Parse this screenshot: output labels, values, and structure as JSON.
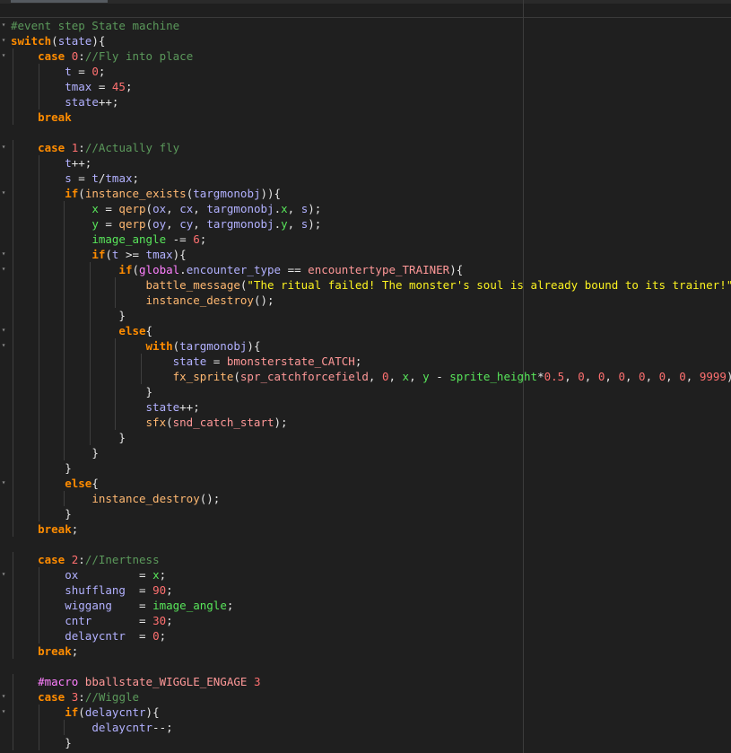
{
  "editor": {
    "colors": {
      "background": "#1f1f1f",
      "default": "#e6e6e6",
      "keyword": "#ff8c00",
      "number": "#ff7070",
      "string": "#fcf320",
      "comment": "#5b995b",
      "function": "#ffb871",
      "variable": "#b2b1ff",
      "builtin_var": "#58e55a",
      "operator": "#ff8080",
      "constant": "#ff8080",
      "global": "#ff80ff"
    },
    "fold_icon": "fold-triangle-icon",
    "lines": [
      {
        "tokens": [
          {
            "t": "#event step State machine",
            "s": "c"
          }
        ]
      },
      {
        "tokens": [
          {
            "t": "switch",
            "s": "k"
          },
          {
            "t": "(",
            "s": "d"
          },
          {
            "t": "state",
            "s": "v"
          },
          {
            "t": "){",
            "s": "d"
          }
        ]
      },
      {
        "tokens": [
          {
            "t": "    ",
            "s": "d"
          },
          {
            "t": "case ",
            "s": "k"
          },
          {
            "t": "0",
            "s": "n"
          },
          {
            "t": ":",
            "s": "d"
          },
          {
            "t": "//Fly into place",
            "s": "c"
          }
        ]
      },
      {
        "tokens": [
          {
            "t": "        ",
            "s": "d"
          },
          {
            "t": "t",
            "s": "v"
          },
          {
            "t": " = ",
            "s": "d"
          },
          {
            "t": "0",
            "s": "n"
          },
          {
            "t": ";",
            "s": "d"
          }
        ]
      },
      {
        "tokens": [
          {
            "t": "        ",
            "s": "d"
          },
          {
            "t": "tmax",
            "s": "v"
          },
          {
            "t": " = ",
            "s": "d"
          },
          {
            "t": "45",
            "s": "n"
          },
          {
            "t": ";",
            "s": "d"
          }
        ]
      },
      {
        "tokens": [
          {
            "t": "        ",
            "s": "d"
          },
          {
            "t": "state",
            "s": "v"
          },
          {
            "t": "++;",
            "s": "d"
          }
        ]
      },
      {
        "tokens": [
          {
            "t": "    ",
            "s": "d"
          },
          {
            "t": "break",
            "s": "k"
          }
        ]
      },
      {
        "tokens": []
      },
      {
        "tokens": [
          {
            "t": "    ",
            "s": "d"
          },
          {
            "t": "case ",
            "s": "k"
          },
          {
            "t": "1",
            "s": "n"
          },
          {
            "t": ":",
            "s": "d"
          },
          {
            "t": "//Actually fly",
            "s": "c"
          }
        ]
      },
      {
        "tokens": [
          {
            "t": "        ",
            "s": "d"
          },
          {
            "t": "t",
            "s": "v"
          },
          {
            "t": "++;",
            "s": "d"
          }
        ]
      },
      {
        "tokens": [
          {
            "t": "        ",
            "s": "d"
          },
          {
            "t": "s",
            "s": "v"
          },
          {
            "t": " = ",
            "s": "d"
          },
          {
            "t": "t",
            "s": "v"
          },
          {
            "t": "/",
            "s": "d"
          },
          {
            "t": "tmax",
            "s": "v"
          },
          {
            "t": ";",
            "s": "d"
          }
        ]
      },
      {
        "tokens": [
          {
            "t": "        ",
            "s": "d"
          },
          {
            "t": "if",
            "s": "k"
          },
          {
            "t": "(",
            "s": "d"
          },
          {
            "t": "instance_exists",
            "s": "f"
          },
          {
            "t": "(",
            "s": "d"
          },
          {
            "t": "targmonobj",
            "s": "v"
          },
          {
            "t": ")){",
            "s": "d"
          }
        ]
      },
      {
        "tokens": [
          {
            "t": "            ",
            "s": "d"
          },
          {
            "t": "x",
            "s": "r"
          },
          {
            "t": " = ",
            "s": "d"
          },
          {
            "t": "qerp",
            "s": "f"
          },
          {
            "t": "(",
            "s": "d"
          },
          {
            "t": "ox",
            "s": "v"
          },
          {
            "t": ", ",
            "s": "d"
          },
          {
            "t": "cx",
            "s": "v"
          },
          {
            "t": ", ",
            "s": "d"
          },
          {
            "t": "targmonobj",
            "s": "v"
          },
          {
            "t": ".",
            "s": "d"
          },
          {
            "t": "x",
            "s": "r"
          },
          {
            "t": ", ",
            "s": "d"
          },
          {
            "t": "s",
            "s": "v"
          },
          {
            "t": ");",
            "s": "d"
          }
        ]
      },
      {
        "tokens": [
          {
            "t": "            ",
            "s": "d"
          },
          {
            "t": "y",
            "s": "r"
          },
          {
            "t": " = ",
            "s": "d"
          },
          {
            "t": "qerp",
            "s": "f"
          },
          {
            "t": "(",
            "s": "d"
          },
          {
            "t": "oy",
            "s": "v"
          },
          {
            "t": ", ",
            "s": "d"
          },
          {
            "t": "cy",
            "s": "v"
          },
          {
            "t": ", ",
            "s": "d"
          },
          {
            "t": "targmonobj",
            "s": "v"
          },
          {
            "t": ".",
            "s": "d"
          },
          {
            "t": "y",
            "s": "r"
          },
          {
            "t": ", ",
            "s": "d"
          },
          {
            "t": "s",
            "s": "v"
          },
          {
            "t": ");",
            "s": "d"
          }
        ]
      },
      {
        "tokens": [
          {
            "t": "            ",
            "s": "d"
          },
          {
            "t": "image_angle",
            "s": "r"
          },
          {
            "t": " -= ",
            "s": "d"
          },
          {
            "t": "6",
            "s": "n"
          },
          {
            "t": ";",
            "s": "d"
          }
        ]
      },
      {
        "tokens": [
          {
            "t": "            ",
            "s": "d"
          },
          {
            "t": "if",
            "s": "k"
          },
          {
            "t": "(",
            "s": "d"
          },
          {
            "t": "t",
            "s": "v"
          },
          {
            "t": " >= ",
            "s": "d"
          },
          {
            "t": "tmax",
            "s": "v"
          },
          {
            "t": "){",
            "s": "d"
          }
        ]
      },
      {
        "tokens": [
          {
            "t": "                ",
            "s": "d"
          },
          {
            "t": "if",
            "s": "k"
          },
          {
            "t": "(",
            "s": "d"
          },
          {
            "t": "global",
            "s": "g"
          },
          {
            "t": ".",
            "s": "d"
          },
          {
            "t": "encounter_type",
            "s": "v"
          },
          {
            "t": " == ",
            "s": "d"
          },
          {
            "t": "encountertype_TRAINER",
            "s": "x"
          },
          {
            "t": "){",
            "s": "d"
          }
        ]
      },
      {
        "tokens": [
          {
            "t": "                    ",
            "s": "d"
          },
          {
            "t": "battle_message",
            "s": "f"
          },
          {
            "t": "(",
            "s": "d"
          },
          {
            "t": "\"The ritual failed! The monster's soul is already bound to its trainer!\"",
            "s": "s"
          },
          {
            "t": ");",
            "s": "d"
          }
        ]
      },
      {
        "tokens": [
          {
            "t": "                    ",
            "s": "d"
          },
          {
            "t": "instance_destroy",
            "s": "f"
          },
          {
            "t": "();",
            "s": "d"
          }
        ]
      },
      {
        "tokens": [
          {
            "t": "                ",
            "s": "d"
          },
          {
            "t": "}",
            "s": "d"
          }
        ]
      },
      {
        "tokens": [
          {
            "t": "                ",
            "s": "d"
          },
          {
            "t": "else",
            "s": "k"
          },
          {
            "t": "{",
            "s": "d"
          }
        ]
      },
      {
        "tokens": [
          {
            "t": "                    ",
            "s": "d"
          },
          {
            "t": "with",
            "s": "k"
          },
          {
            "t": "(",
            "s": "d"
          },
          {
            "t": "targmonobj",
            "s": "v"
          },
          {
            "t": "){",
            "s": "d"
          }
        ]
      },
      {
        "tokens": [
          {
            "t": "                        ",
            "s": "d"
          },
          {
            "t": "state",
            "s": "v"
          },
          {
            "t": " = ",
            "s": "d"
          },
          {
            "t": "bmonsterstate_CATCH",
            "s": "x"
          },
          {
            "t": ";",
            "s": "d"
          }
        ]
      },
      {
        "tokens": [
          {
            "t": "                        ",
            "s": "d"
          },
          {
            "t": "fx_sprite",
            "s": "f"
          },
          {
            "t": "(",
            "s": "d"
          },
          {
            "t": "spr_catchforcefield",
            "s": "x"
          },
          {
            "t": ", ",
            "s": "d"
          },
          {
            "t": "0",
            "s": "n"
          },
          {
            "t": ", ",
            "s": "d"
          },
          {
            "t": "x",
            "s": "r"
          },
          {
            "t": ", ",
            "s": "d"
          },
          {
            "t": "y",
            "s": "r"
          },
          {
            "t": " - ",
            "s": "d"
          },
          {
            "t": "sprite_height",
            "s": "r"
          },
          {
            "t": "*",
            "s": "d"
          },
          {
            "t": "0.5",
            "s": "n"
          },
          {
            "t": ", ",
            "s": "d"
          },
          {
            "t": "0",
            "s": "n"
          },
          {
            "t": ", ",
            "s": "d"
          },
          {
            "t": "0",
            "s": "n"
          },
          {
            "t": ", ",
            "s": "d"
          },
          {
            "t": "0",
            "s": "n"
          },
          {
            "t": ", ",
            "s": "d"
          },
          {
            "t": "0",
            "s": "n"
          },
          {
            "t": ", ",
            "s": "d"
          },
          {
            "t": "0",
            "s": "n"
          },
          {
            "t": ", ",
            "s": "d"
          },
          {
            "t": "0",
            "s": "n"
          },
          {
            "t": ", ",
            "s": "d"
          },
          {
            "t": "9999",
            "s": "n"
          },
          {
            "t": ");",
            "s": "d"
          }
        ]
      },
      {
        "tokens": [
          {
            "t": "                    ",
            "s": "d"
          },
          {
            "t": "}",
            "s": "d"
          }
        ]
      },
      {
        "tokens": [
          {
            "t": "                    ",
            "s": "d"
          },
          {
            "t": "state",
            "s": "v"
          },
          {
            "t": "++;",
            "s": "d"
          }
        ]
      },
      {
        "tokens": [
          {
            "t": "                    ",
            "s": "d"
          },
          {
            "t": "sfx",
            "s": "f"
          },
          {
            "t": "(",
            "s": "d"
          },
          {
            "t": "snd_catch_start",
            "s": "x"
          },
          {
            "t": ");",
            "s": "d"
          }
        ]
      },
      {
        "tokens": [
          {
            "t": "                ",
            "s": "d"
          },
          {
            "t": "}",
            "s": "d"
          }
        ]
      },
      {
        "tokens": [
          {
            "t": "            ",
            "s": "d"
          },
          {
            "t": "}",
            "s": "d"
          }
        ]
      },
      {
        "tokens": [
          {
            "t": "        ",
            "s": "d"
          },
          {
            "t": "}",
            "s": "d"
          }
        ]
      },
      {
        "tokens": [
          {
            "t": "        ",
            "s": "d"
          },
          {
            "t": "else",
            "s": "k"
          },
          {
            "t": "{",
            "s": "d"
          }
        ]
      },
      {
        "tokens": [
          {
            "t": "            ",
            "s": "d"
          },
          {
            "t": "instance_destroy",
            "s": "f"
          },
          {
            "t": "();",
            "s": "d"
          }
        ]
      },
      {
        "tokens": [
          {
            "t": "        ",
            "s": "d"
          },
          {
            "t": "}",
            "s": "d"
          }
        ]
      },
      {
        "tokens": [
          {
            "t": "    ",
            "s": "d"
          },
          {
            "t": "break",
            "s": "k"
          },
          {
            "t": ";",
            "s": "d"
          }
        ]
      },
      {
        "tokens": []
      },
      {
        "tokens": [
          {
            "t": "    ",
            "s": "d"
          },
          {
            "t": "case ",
            "s": "k"
          },
          {
            "t": "2",
            "s": "n"
          },
          {
            "t": ":",
            "s": "d"
          },
          {
            "t": "//Inertness",
            "s": "c"
          }
        ]
      },
      {
        "tokens": [
          {
            "t": "        ",
            "s": "d"
          },
          {
            "t": "ox",
            "s": "v"
          },
          {
            "t": "         = ",
            "s": "d"
          },
          {
            "t": "x",
            "s": "r"
          },
          {
            "t": ";",
            "s": "d"
          }
        ]
      },
      {
        "tokens": [
          {
            "t": "        ",
            "s": "d"
          },
          {
            "t": "shufflang",
            "s": "v"
          },
          {
            "t": "  = ",
            "s": "d"
          },
          {
            "t": "90",
            "s": "n"
          },
          {
            "t": ";",
            "s": "d"
          }
        ]
      },
      {
        "tokens": [
          {
            "t": "        ",
            "s": "d"
          },
          {
            "t": "wiggang",
            "s": "v"
          },
          {
            "t": "    = ",
            "s": "d"
          },
          {
            "t": "image_angle",
            "s": "r"
          },
          {
            "t": ";",
            "s": "d"
          }
        ]
      },
      {
        "tokens": [
          {
            "t": "        ",
            "s": "d"
          },
          {
            "t": "cntr",
            "s": "v"
          },
          {
            "t": "       = ",
            "s": "d"
          },
          {
            "t": "30",
            "s": "n"
          },
          {
            "t": ";",
            "s": "d"
          }
        ]
      },
      {
        "tokens": [
          {
            "t": "        ",
            "s": "d"
          },
          {
            "t": "delaycntr",
            "s": "v"
          },
          {
            "t": "  = ",
            "s": "d"
          },
          {
            "t": "0",
            "s": "n"
          },
          {
            "t": ";",
            "s": "d"
          }
        ]
      },
      {
        "tokens": [
          {
            "t": "    ",
            "s": "d"
          },
          {
            "t": "break",
            "s": "k"
          },
          {
            "t": ";",
            "s": "d"
          }
        ]
      },
      {
        "tokens": []
      },
      {
        "tokens": [
          {
            "t": "    ",
            "s": "d"
          },
          {
            "t": "#macro ",
            "s": "g"
          },
          {
            "t": "bballstate_WIGGLE_ENGAGE ",
            "s": "x"
          },
          {
            "t": "3",
            "s": "n"
          }
        ]
      },
      {
        "tokens": [
          {
            "t": "    ",
            "s": "d"
          },
          {
            "t": "case ",
            "s": "k"
          },
          {
            "t": "3",
            "s": "n"
          },
          {
            "t": ":",
            "s": "d"
          },
          {
            "t": "//Wiggle",
            "s": "c"
          }
        ]
      },
      {
        "tokens": [
          {
            "t": "        ",
            "s": "d"
          },
          {
            "t": "if",
            "s": "k"
          },
          {
            "t": "(",
            "s": "d"
          },
          {
            "t": "delaycntr",
            "s": "v"
          },
          {
            "t": "){",
            "s": "d"
          }
        ]
      },
      {
        "tokens": [
          {
            "t": "            ",
            "s": "d"
          },
          {
            "t": "delaycntr",
            "s": "v"
          },
          {
            "t": "--;",
            "s": "d"
          }
        ]
      },
      {
        "tokens": [
          {
            "t": "        ",
            "s": "d"
          },
          {
            "t": "}",
            "s": "d"
          }
        ]
      }
    ],
    "fold_lines": [
      0,
      1,
      2,
      8,
      11,
      15,
      16,
      20,
      21,
      30,
      36,
      44,
      45
    ]
  }
}
